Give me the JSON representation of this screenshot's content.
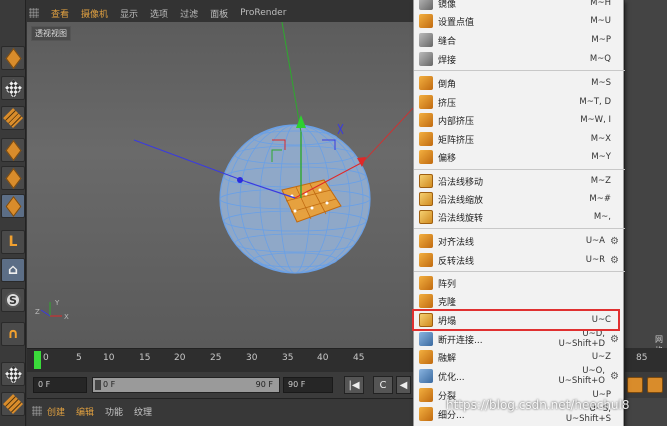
{
  "viewport": {
    "menu": [
      "查看",
      "摄像机",
      "显示",
      "选项",
      "过滤",
      "面板",
      "ProRender"
    ],
    "view_name": "透视视图"
  },
  "context_menu": {
    "items": [
      {
        "label": "镜像",
        "shortcut": "M~H",
        "icon": "mirror-icon"
      },
      {
        "label": "设置点值",
        "shortcut": "M~U",
        "icon": "set-point-value-icon"
      },
      {
        "label": "缝合",
        "shortcut": "M~P",
        "icon": "stitch-icon"
      },
      {
        "label": "焊接",
        "shortcut": "M~Q",
        "icon": "weld-icon"
      },
      {
        "label": "倒角",
        "shortcut": "M~S",
        "icon": "bevel-icon"
      },
      {
        "label": "挤压",
        "shortcut": "M~T, D",
        "icon": "extrude-icon"
      },
      {
        "label": "内部挤压",
        "shortcut": "M~W, I",
        "icon": "extrude-inner-icon"
      },
      {
        "label": "矩阵挤压",
        "shortcut": "M~X",
        "icon": "matrix-extrude-icon"
      },
      {
        "label": "偏移",
        "shortcut": "M~Y",
        "icon": "offset-icon"
      },
      {
        "label": "沿法线移动",
        "shortcut": "M~Z",
        "icon": "normal-move-icon"
      },
      {
        "label": "沿法线缩放",
        "shortcut": "M~#",
        "icon": "normal-scale-icon"
      },
      {
        "label": "沿法线旋转",
        "shortcut": "M~,",
        "icon": "normal-rotate-icon"
      },
      {
        "label": "对齐法线",
        "shortcut": "U~A",
        "icon": "align-normals-icon",
        "gear": true
      },
      {
        "label": "反转法线",
        "shortcut": "U~R",
        "icon": "reverse-normals-icon",
        "gear": true
      },
      {
        "label": "阵列",
        "shortcut": "",
        "icon": "array-icon"
      },
      {
        "label": "克隆",
        "shortcut": "",
        "icon": "clone-icon"
      },
      {
        "label": "坍塌",
        "shortcut": "U~C",
        "icon": "collapse-icon"
      },
      {
        "label": "断开连接...",
        "shortcut": "U~D, U~Shift+D",
        "icon": "disconnect-icon",
        "gear": true
      },
      {
        "label": "融解",
        "shortcut": "U~Z",
        "icon": "dissolve-icon"
      },
      {
        "label": "优化...",
        "shortcut": "U~O, U~Shift+O",
        "icon": "optimize-icon",
        "gear": true
      },
      {
        "label": "分裂",
        "shortcut": "U~P",
        "icon": "split-icon"
      },
      {
        "label": "细分...",
        "shortcut": "U~S, U~Shift+S",
        "icon": "subdivide-icon"
      }
    ],
    "highlighted": "坍塌",
    "highlight_color": "#e03030"
  },
  "right_panel": {
    "label": "网格"
  },
  "timeline": {
    "ticks": [
      "0",
      "5",
      "10",
      "15",
      "20",
      "25",
      "30",
      "35",
      "40",
      "45"
    ],
    "end_tick": "85",
    "playhead_color": "#3adc3a"
  },
  "transport": {
    "start_field": "0 F",
    "slider_start": "0 F",
    "slider_end": "90 F",
    "end_field": "90 F"
  },
  "bottom_tabs": [
    "创建",
    "编辑",
    "功能",
    "纹理"
  ],
  "active_bottom_tab": "编辑",
  "watermark": "https://blog.csdn.net/heechul8",
  "colors": {
    "accent": "#e0a040",
    "mesh": "#6aa0e6",
    "selection": "#f0a030"
  }
}
